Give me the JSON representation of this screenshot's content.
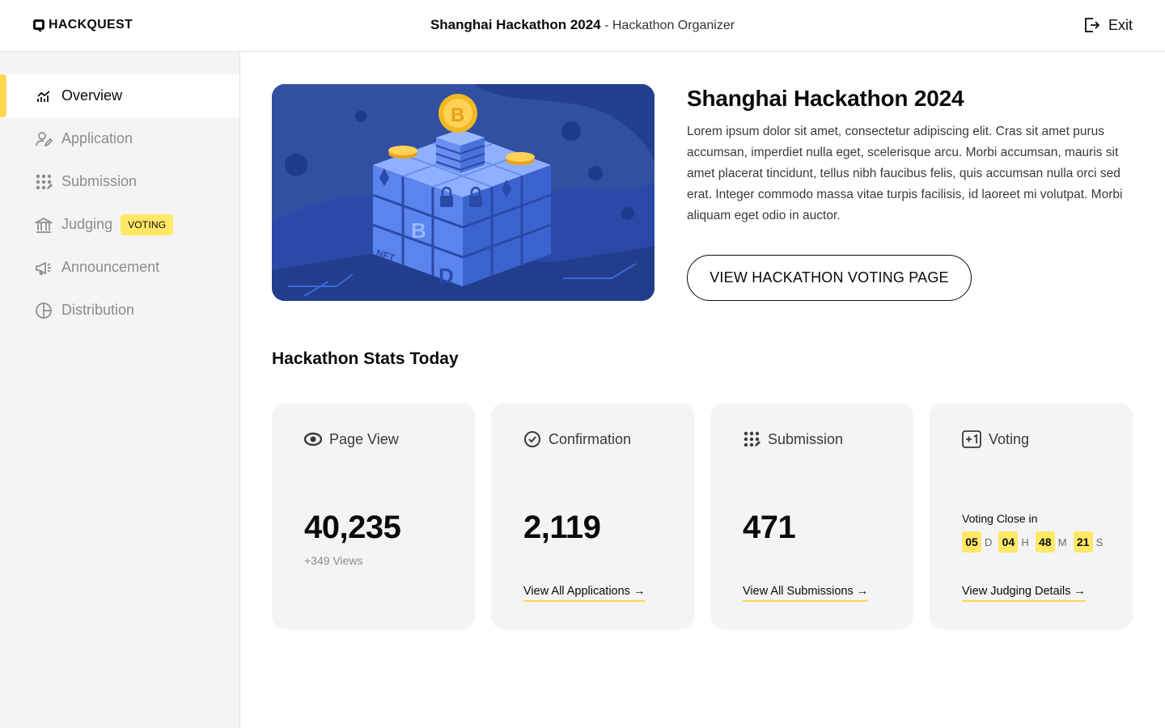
{
  "header": {
    "logo_text": "HACKQUEST",
    "title": "Shanghai Hackathon 2024",
    "separator": " - ",
    "role": "Hackathon Organizer",
    "exit_label": "Exit"
  },
  "sidebar": {
    "items": [
      {
        "label": "Overview",
        "icon": "chart-icon",
        "active": true
      },
      {
        "label": "Application",
        "icon": "user-edit-icon",
        "active": false
      },
      {
        "label": "Submission",
        "icon": "dots-grid-icon",
        "active": false
      },
      {
        "label": "Judging",
        "icon": "bank-icon",
        "active": false,
        "badge": "VOTING"
      },
      {
        "label": "Announcement",
        "icon": "megaphone-icon",
        "active": false
      },
      {
        "label": "Distribution",
        "icon": "pie-icon",
        "active": false
      }
    ]
  },
  "hero": {
    "title": "Shanghai Hackathon 2024",
    "description": "Lorem ipsum dolor sit amet, consectetur adipiscing elit. Cras sit amet purus accumsan, imperdiet nulla eget, scelerisque arcu. Morbi accumsan, mauris sit amet placerat tincidunt, tellus nibh faucibus felis, quis accumsan nulla orci sed erat. Integer commodo massa vitae turpis facilisis, id laoreet mi volutpat. Morbi aliquam eget odio in auctor.",
    "button_label": "VIEW HACKATHON VOTING PAGE",
    "image_labels": {
      "bitcoin": "B",
      "nft": "NFT",
      "d": "D"
    }
  },
  "stats": {
    "title": "Hackathon Stats Today",
    "cards": [
      {
        "label": "Page View",
        "icon": "eye-icon",
        "value": "40,235",
        "sub": "+349 Views"
      },
      {
        "label": "Confirmation",
        "icon": "check-circle-icon",
        "value": "2,119",
        "link": "View All Applications →"
      },
      {
        "label": "Submission",
        "icon": "dots-grid-icon",
        "value": "471",
        "link": "View All Submissions →"
      },
      {
        "label": "Voting",
        "icon": "plus-one-icon",
        "close_label": "Voting Close in",
        "countdown": [
          {
            "num": "05",
            "unit": "D"
          },
          {
            "num": "04",
            "unit": "H"
          },
          {
            "num": "48",
            "unit": "M"
          },
          {
            "num": "21",
            "unit": "S"
          }
        ],
        "link": "View Judging Details →"
      }
    ]
  },
  "colors": {
    "accent": "#ffd850",
    "badge": "#ffe866",
    "hero_bg": "#2b4aa8",
    "panel": "#f4f4f4"
  }
}
